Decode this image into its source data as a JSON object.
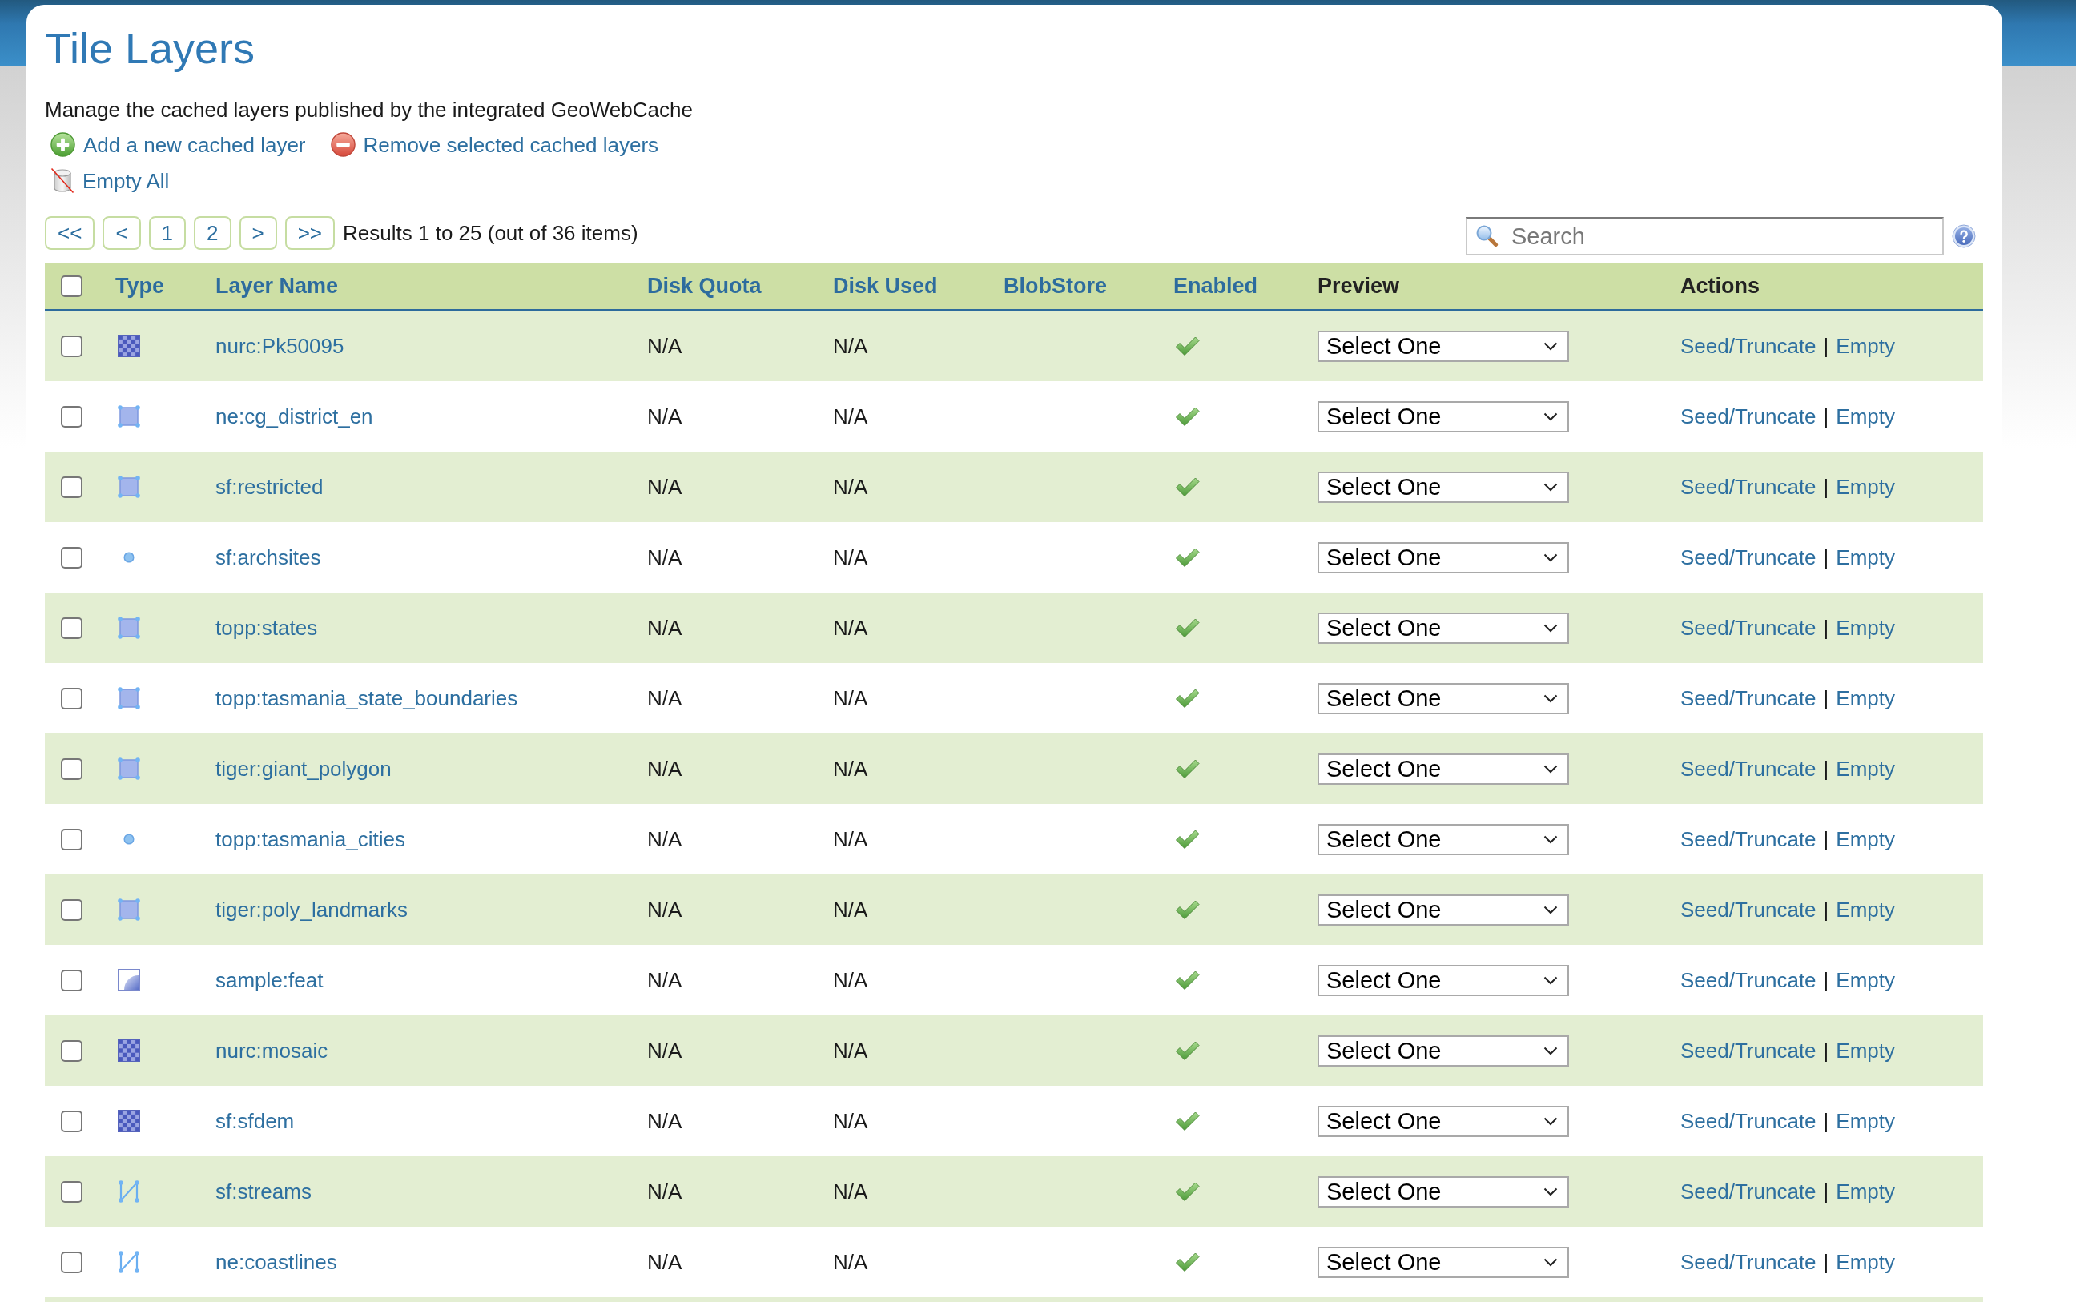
{
  "page": {
    "title": "Tile Layers",
    "description": "Manage the cached layers published by the integrated GeoWebCache",
    "action_rows": [
      [
        {
          "kind": "add",
          "label": "Add a new cached layer"
        },
        {
          "kind": "remove",
          "label": "Remove selected cached layers"
        }
      ],
      [
        {
          "kind": "empty",
          "label": "Empty All"
        }
      ]
    ]
  },
  "pager": {
    "buttons": [
      "<<",
      "<",
      "1",
      "2",
      ">",
      ">>"
    ],
    "results": "Results 1 to 25 (out of 36 items)"
  },
  "search": {
    "placeholder": "Search"
  },
  "table": {
    "select_all": {
      "checked": false
    },
    "columns": [
      {
        "label": "Type",
        "sortable": true
      },
      {
        "label": "Layer Name",
        "sortable": true
      },
      {
        "label": "Disk Quota",
        "sortable": true
      },
      {
        "label": "Disk Used",
        "sortable": true
      },
      {
        "label": "BlobStore",
        "sortable": true
      },
      {
        "label": "Enabled",
        "sortable": true
      },
      {
        "label": "Preview",
        "sortable": false
      },
      {
        "label": "Actions",
        "sortable": false
      }
    ],
    "rows": [
      {
        "checked": false,
        "kind": "raster",
        "name": "nurc:Pk50095",
        "disk_quota": "N/A",
        "disk_used": "N/A",
        "enabled": true,
        "preview": "Select One",
        "seed_link": "Seed/Truncate",
        "separator": "|",
        "empty_link": "Empty"
      },
      {
        "checked": false,
        "kind": "polygon",
        "name": "ne:cg_district_en",
        "disk_quota": "N/A",
        "disk_used": "N/A",
        "enabled": true,
        "preview": "Select One",
        "seed_link": "Seed/Truncate",
        "separator": "|",
        "empty_link": "Empty"
      },
      {
        "checked": false,
        "kind": "polygon",
        "name": "sf:restricted",
        "disk_quota": "N/A",
        "disk_used": "N/A",
        "enabled": true,
        "preview": "Select One",
        "seed_link": "Seed/Truncate",
        "separator": "|",
        "empty_link": "Empty"
      },
      {
        "checked": false,
        "kind": "point",
        "name": "sf:archsites",
        "disk_quota": "N/A",
        "disk_used": "N/A",
        "enabled": true,
        "preview": "Select One",
        "seed_link": "Seed/Truncate",
        "separator": "|",
        "empty_link": "Empty"
      },
      {
        "checked": false,
        "kind": "polygon",
        "name": "topp:states",
        "disk_quota": "N/A",
        "disk_used": "N/A",
        "enabled": true,
        "preview": "Select One",
        "seed_link": "Seed/Truncate",
        "separator": "|",
        "empty_link": "Empty"
      },
      {
        "checked": false,
        "kind": "polygon",
        "name": "topp:tasmania_state_boundaries",
        "disk_quota": "N/A",
        "disk_used": "N/A",
        "enabled": true,
        "preview": "Select One",
        "seed_link": "Seed/Truncate",
        "separator": "|",
        "empty_link": "Empty"
      },
      {
        "checked": false,
        "kind": "polygon",
        "name": "tiger:giant_polygon",
        "disk_quota": "N/A",
        "disk_used": "N/A",
        "enabled": true,
        "preview": "Select One",
        "seed_link": "Seed/Truncate",
        "separator": "|",
        "empty_link": "Empty"
      },
      {
        "checked": false,
        "kind": "point",
        "name": "topp:tasmania_cities",
        "disk_quota": "N/A",
        "disk_used": "N/A",
        "enabled": true,
        "preview": "Select One",
        "seed_link": "Seed/Truncate",
        "separator": "|",
        "empty_link": "Empty"
      },
      {
        "checked": false,
        "kind": "polygon",
        "name": "tiger:poly_landmarks",
        "disk_quota": "N/A",
        "disk_used": "N/A",
        "enabled": true,
        "preview": "Select One",
        "seed_link": "Seed/Truncate",
        "separator": "|",
        "empty_link": "Empty"
      },
      {
        "checked": false,
        "kind": "generic",
        "name": "sample:feat",
        "disk_quota": "N/A",
        "disk_used": "N/A",
        "enabled": true,
        "preview": "Select One",
        "seed_link": "Seed/Truncate",
        "separator": "|",
        "empty_link": "Empty"
      },
      {
        "checked": false,
        "kind": "raster",
        "name": "nurc:mosaic",
        "disk_quota": "N/A",
        "disk_used": "N/A",
        "enabled": true,
        "preview": "Select One",
        "seed_link": "Seed/Truncate",
        "separator": "|",
        "empty_link": "Empty"
      },
      {
        "checked": false,
        "kind": "raster",
        "name": "sf:sfdem",
        "disk_quota": "N/A",
        "disk_used": "N/A",
        "enabled": true,
        "preview": "Select One",
        "seed_link": "Seed/Truncate",
        "separator": "|",
        "empty_link": "Empty"
      },
      {
        "checked": false,
        "kind": "line",
        "name": "sf:streams",
        "disk_quota": "N/A",
        "disk_used": "N/A",
        "enabled": true,
        "preview": "Select One",
        "seed_link": "Seed/Truncate",
        "separator": "|",
        "empty_link": "Empty"
      },
      {
        "checked": false,
        "kind": "line",
        "name": "ne:coastlines",
        "disk_quota": "N/A",
        "disk_used": "N/A",
        "enabled": true,
        "preview": "Select One",
        "seed_link": "Seed/Truncate",
        "separator": "|",
        "empty_link": "Empty"
      }
    ]
  }
}
